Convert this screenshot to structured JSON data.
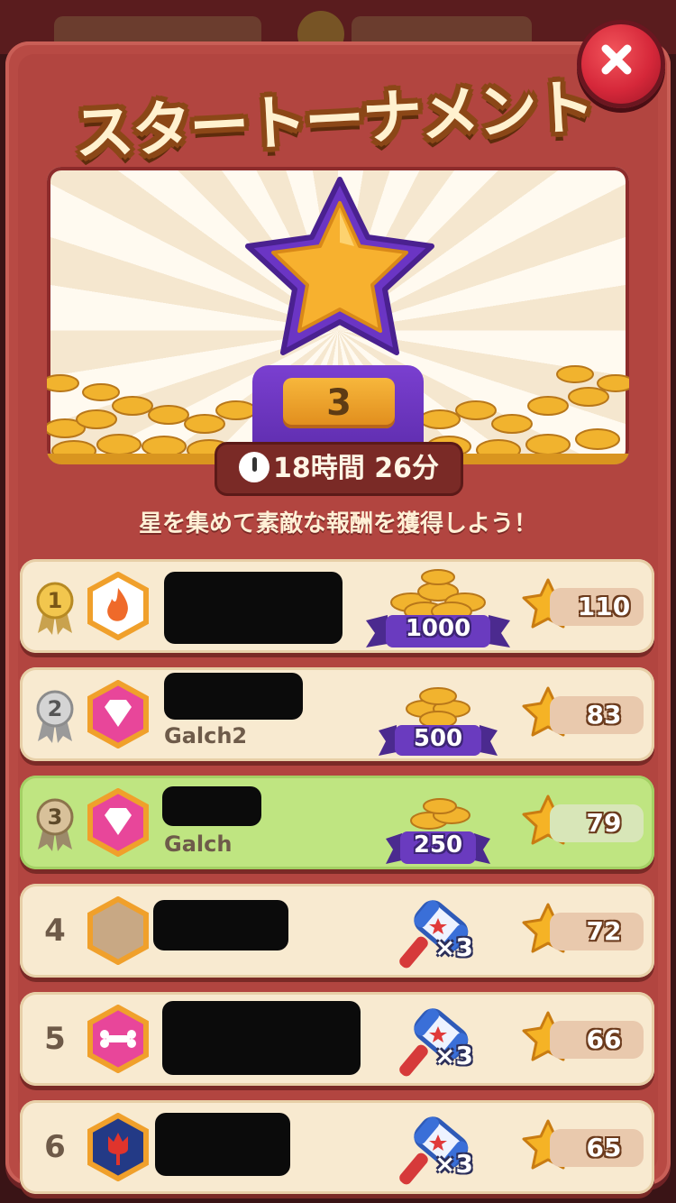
{
  "title": "スタートーナメント",
  "hero": {
    "trophy_rank": "3"
  },
  "timer": {
    "text": "18時間 26分"
  },
  "subtitle": "星を集めて素敵な報酬を獲得しよう！",
  "close_icon": "close-icon",
  "leaderboard": [
    {
      "rank": "1",
      "name": "",
      "avatar": "fire-badge",
      "reward": "1000",
      "reward_type": "coins",
      "score": "110",
      "medal": "gold"
    },
    {
      "rank": "2",
      "name": "Galch2",
      "avatar": "diamond-badge",
      "reward": "500",
      "reward_type": "coins",
      "score": "83",
      "medal": "silver"
    },
    {
      "rank": "3",
      "name": "Galch",
      "avatar": "diamond-badge",
      "reward": "250",
      "reward_type": "coins",
      "score": "79",
      "medal": "bronze",
      "is_me": true
    },
    {
      "rank": "4",
      "name": "",
      "avatar": "empty-badge",
      "reward": "×3",
      "reward_type": "hammer",
      "score": "72"
    },
    {
      "rank": "5",
      "name": "",
      "avatar": "bone-badge",
      "reward": "×3",
      "reward_type": "hammer",
      "score": "66"
    },
    {
      "rank": "6",
      "name": "",
      "avatar": "tulip-badge",
      "reward": "×3",
      "reward_type": "hammer",
      "score": "65"
    }
  ],
  "colors": {
    "panel": "#b84a44",
    "row": "#f8ead0",
    "row_me": "#bfe581",
    "banner_purple": "#6a3bbf",
    "star_gold": "#f5b326"
  }
}
